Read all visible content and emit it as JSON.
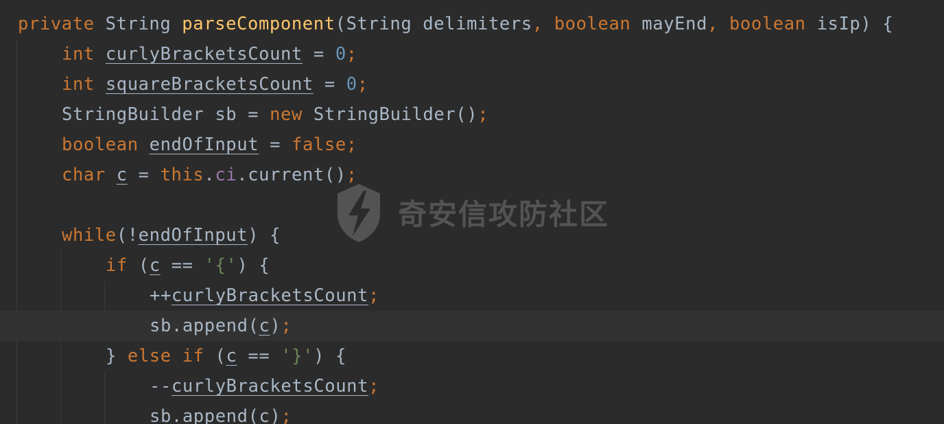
{
  "editor": {
    "language": "java",
    "current_line": 10,
    "lines": [
      {
        "indent": 0,
        "tokens": [
          {
            "t": "private ",
            "c": "kw"
          },
          {
            "t": "String ",
            "c": "plain"
          },
          {
            "t": "parseComponent",
            "c": "fn"
          },
          {
            "t": "(String delimiters",
            "c": "plain"
          },
          {
            "t": ", ",
            "c": "kw"
          },
          {
            "t": "boolean ",
            "c": "kw"
          },
          {
            "t": "mayEnd",
            "c": "plain"
          },
          {
            "t": ", ",
            "c": "kw"
          },
          {
            "t": "boolean ",
            "c": "kw"
          },
          {
            "t": "isIp) {",
            "c": "plain"
          }
        ]
      },
      {
        "indent": 1,
        "tokens": [
          {
            "t": "int ",
            "c": "kw"
          },
          {
            "t": "curlyBracketsCount",
            "c": "plain",
            "u": true
          },
          {
            "t": " = ",
            "c": "plain"
          },
          {
            "t": "0",
            "c": "num"
          },
          {
            "t": ";",
            "c": "kw"
          }
        ]
      },
      {
        "indent": 1,
        "tokens": [
          {
            "t": "int ",
            "c": "kw"
          },
          {
            "t": "squareBracketsCount",
            "c": "plain",
            "u": true
          },
          {
            "t": " = ",
            "c": "plain"
          },
          {
            "t": "0",
            "c": "num"
          },
          {
            "t": ";",
            "c": "kw"
          }
        ]
      },
      {
        "indent": 1,
        "tokens": [
          {
            "t": "StringBuilder sb = ",
            "c": "plain"
          },
          {
            "t": "new ",
            "c": "kw"
          },
          {
            "t": "StringBuilder()",
            "c": "plain"
          },
          {
            "t": ";",
            "c": "kw"
          }
        ]
      },
      {
        "indent": 1,
        "tokens": [
          {
            "t": "boolean ",
            "c": "kw"
          },
          {
            "t": "endOfInput",
            "c": "plain",
            "u": true
          },
          {
            "t": " = ",
            "c": "plain"
          },
          {
            "t": "false;",
            "c": "kw"
          }
        ]
      },
      {
        "indent": 1,
        "tokens": [
          {
            "t": "char ",
            "c": "kw"
          },
          {
            "t": "c",
            "c": "plain",
            "u": true
          },
          {
            "t": " = ",
            "c": "plain"
          },
          {
            "t": "this",
            "c": "kw"
          },
          {
            "t": ".",
            "c": "plain"
          },
          {
            "t": "ci",
            "c": "fld"
          },
          {
            "t": ".current()",
            "c": "plain"
          },
          {
            "t": ";",
            "c": "kw"
          }
        ]
      },
      {
        "indent": 0,
        "tokens": []
      },
      {
        "indent": 1,
        "tokens": [
          {
            "t": "while",
            "c": "kw"
          },
          {
            "t": "(!",
            "c": "plain"
          },
          {
            "t": "endOfInput",
            "c": "plain",
            "u": true
          },
          {
            "t": ") {",
            "c": "plain"
          }
        ]
      },
      {
        "indent": 2,
        "tokens": [
          {
            "t": "if ",
            "c": "kw"
          },
          {
            "t": "(",
            "c": "plain"
          },
          {
            "t": "c",
            "c": "plain",
            "u": true
          },
          {
            "t": " == ",
            "c": "plain"
          },
          {
            "t": "'{'",
            "c": "str"
          },
          {
            "t": ") {",
            "c": "plain"
          }
        ]
      },
      {
        "indent": 3,
        "tokens": [
          {
            "t": "++",
            "c": "plain"
          },
          {
            "t": "curlyBracketsCount",
            "c": "plain",
            "u": true
          },
          {
            "t": ";",
            "c": "kw"
          }
        ]
      },
      {
        "indent": 3,
        "tokens": [
          {
            "t": "sb.append(",
            "c": "plain"
          },
          {
            "t": "c",
            "c": "plain",
            "u": true
          },
          {
            "t": ")",
            "c": "plain"
          },
          {
            "t": ";",
            "c": "kw"
          }
        ]
      },
      {
        "indent": 2,
        "tokens": [
          {
            "t": "} ",
            "c": "plain"
          },
          {
            "t": "else if ",
            "c": "kw"
          },
          {
            "t": "(",
            "c": "plain"
          },
          {
            "t": "c",
            "c": "plain",
            "u": true
          },
          {
            "t": " == ",
            "c": "plain"
          },
          {
            "t": "'}'",
            "c": "str"
          },
          {
            "t": ") {",
            "c": "plain"
          }
        ]
      },
      {
        "indent": 3,
        "tokens": [
          {
            "t": "--",
            "c": "plain"
          },
          {
            "t": "curlyBracketsCount",
            "c": "plain",
            "u": true
          },
          {
            "t": ";",
            "c": "kw"
          }
        ]
      },
      {
        "indent": 3,
        "tokens": [
          {
            "t": "sb.append(",
            "c": "plain"
          },
          {
            "t": "c",
            "c": "plain",
            "u": true
          },
          {
            "t": ")",
            "c": "plain"
          },
          {
            "t": ";",
            "c": "kw"
          }
        ]
      }
    ]
  },
  "watermark": {
    "text": "奇安信攻防社区",
    "icon": "lightning-shield-icon"
  }
}
